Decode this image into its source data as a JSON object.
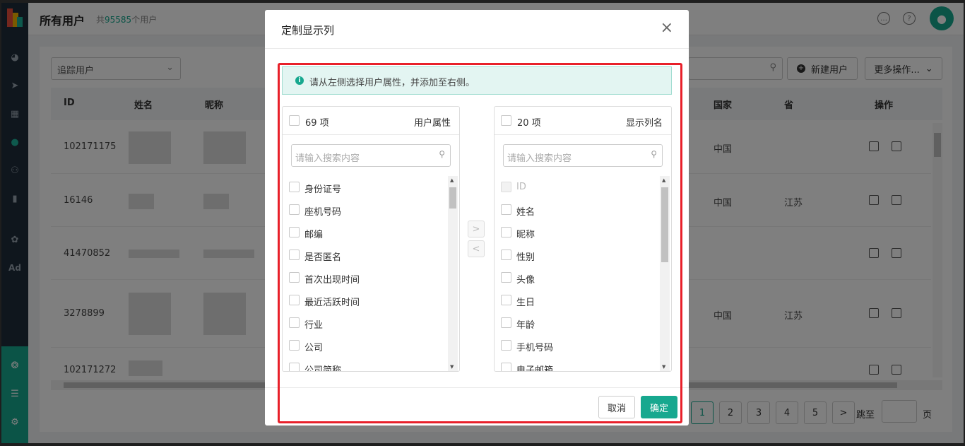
{
  "topbar": {
    "title": "所有用户",
    "count_prefix": "共",
    "count_value": "95585",
    "count_suffix": "个用户"
  },
  "sidebar": {
    "items": [
      "dashboard-icon",
      "send-icon",
      "layout-icon",
      "user-icon",
      "users-icon",
      "chart-icon",
      "wechat-icon",
      "ad-icon"
    ],
    "ad_label": "Ad",
    "bottom_items": [
      "settings-cog-icon",
      "server-icon",
      "gear-icon"
    ]
  },
  "toolbar": {
    "filter_value": "追踪用户",
    "new_user": "新建用户",
    "more_actions": "更多操作..."
  },
  "table": {
    "headers": {
      "id": "ID",
      "name": "姓名",
      "nickname": "昵称",
      "country": "国家",
      "province": "省",
      "actions": "操作"
    },
    "rows": [
      {
        "id": "102171175",
        "country": "中国",
        "province": ""
      },
      {
        "id": "16146",
        "country": "中国",
        "province": "江苏"
      },
      {
        "id": "41470852",
        "country": "",
        "province": ""
      },
      {
        "id": "3278899",
        "country": "中国",
        "province": "江苏"
      },
      {
        "id": "102171272",
        "country": "",
        "province": ""
      }
    ]
  },
  "pagination": {
    "pages": [
      "1",
      "2",
      "3",
      "4",
      "5"
    ],
    "next": ">",
    "jump_label": "跳至",
    "page_unit": "页"
  },
  "modal": {
    "title": "定制显示列",
    "close": "×",
    "notice": "请从左侧选择用户属性，并添加至右侧。",
    "left": {
      "count": "69 项",
      "title": "用户属性",
      "search_placeholder": "请输入搜索内容",
      "items": [
        "身份证号",
        "座机号码",
        "邮编",
        "是否匿名",
        "首次出现时间",
        "最近活跃时间",
        "行业",
        "公司",
        "公司简称"
      ]
    },
    "right": {
      "count": "20 项",
      "title": "显示列名",
      "search_placeholder": "请输入搜索内容",
      "items": [
        "ID",
        "姓名",
        "昵称",
        "性别",
        "头像",
        "生日",
        "年龄",
        "手机号码",
        "电子邮箱"
      ]
    },
    "move_right": ">",
    "move_left": "<",
    "cancel": "取消",
    "confirm": "确定"
  },
  "colors": {
    "accent": "#17a88f",
    "highlight": "#e8202a",
    "sidebar": "#1e2d3b"
  }
}
